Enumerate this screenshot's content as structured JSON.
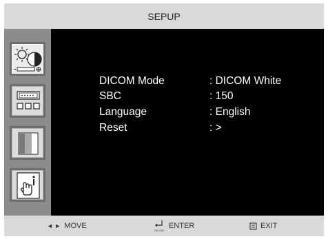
{
  "title": "SEPUP",
  "sidebar": {
    "items": [
      {
        "icon": "brightness-contrast-icon",
        "selected": true
      },
      {
        "icon": "input-connector-icon",
        "selected": false
      },
      {
        "icon": "color-panel-icon",
        "selected": false
      },
      {
        "icon": "setup-hand-icon",
        "selected": false
      }
    ]
  },
  "menu": [
    {
      "label": "DICOM Mode",
      "value": ": DICOM White"
    },
    {
      "label": "SBC",
      "value": ": 150"
    },
    {
      "label": "Language",
      "value": ": English"
    },
    {
      "label": "Reset",
      "value": ": >"
    }
  ],
  "footer": {
    "move": {
      "glyph": "◄ ►",
      "label": "MOVE"
    },
    "enter": {
      "glyph_caption": "DICOM",
      "label": "ENTER"
    },
    "exit": {
      "label": "EXIT"
    }
  },
  "colors": {
    "bar": "#d9d9d9",
    "sidebar": "#8c8c8c",
    "tile_frame": "#6d6d6d",
    "main": "#000000",
    "text": "#ffffff"
  }
}
